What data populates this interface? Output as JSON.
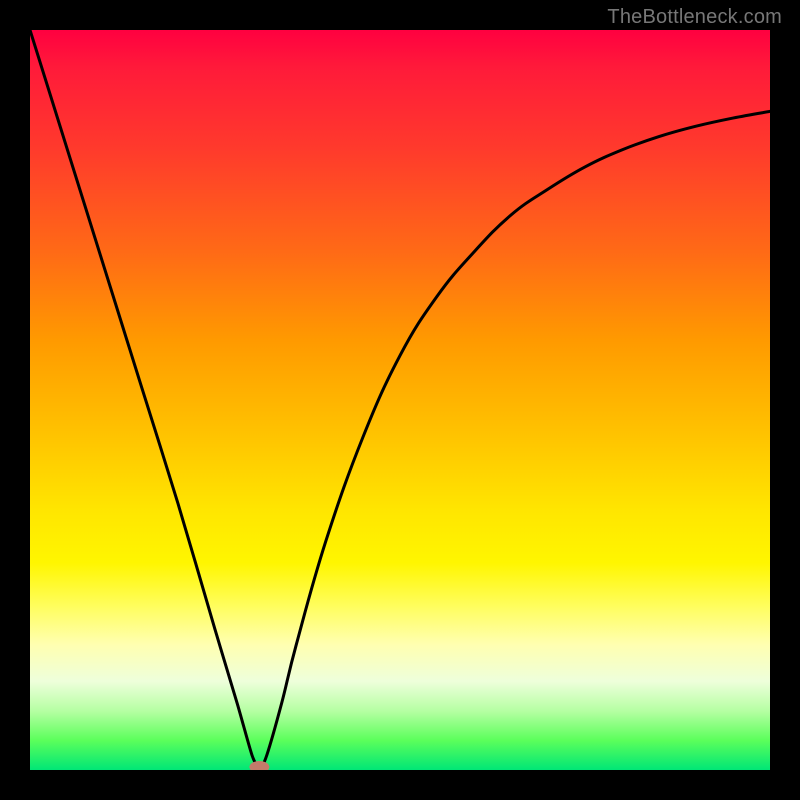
{
  "watermark": "TheBottleneck.com",
  "chart_data": {
    "type": "line",
    "title": "",
    "xlabel": "",
    "ylabel": "",
    "xlim": [
      0,
      100
    ],
    "ylim": [
      0,
      100
    ],
    "series": [
      {
        "name": "curve",
        "x": [
          0,
          5,
          10,
          15,
          20,
          25,
          28,
          30,
          31,
          32,
          34,
          36,
          40,
          45,
          50,
          55,
          60,
          65,
          70,
          75,
          80,
          85,
          90,
          95,
          100
        ],
        "values": [
          100,
          84,
          68,
          52,
          36,
          19,
          9,
          2,
          0,
          2,
          9,
          17,
          31,
          45,
          56,
          64,
          70,
          75,
          78.5,
          81.5,
          83.8,
          85.6,
          87,
          88.1,
          89
        ]
      }
    ],
    "markers": [
      {
        "name": "min-marker",
        "x": 31,
        "y": 0,
        "color": "#c47b6a",
        "rx": 10,
        "ry": 6
      }
    ],
    "background_gradient": {
      "top": "#ff0040",
      "mid_upper": "#ff9a00",
      "mid": "#ffe600",
      "mid_lower": "#fffe60",
      "bottom": "#00e676"
    }
  }
}
